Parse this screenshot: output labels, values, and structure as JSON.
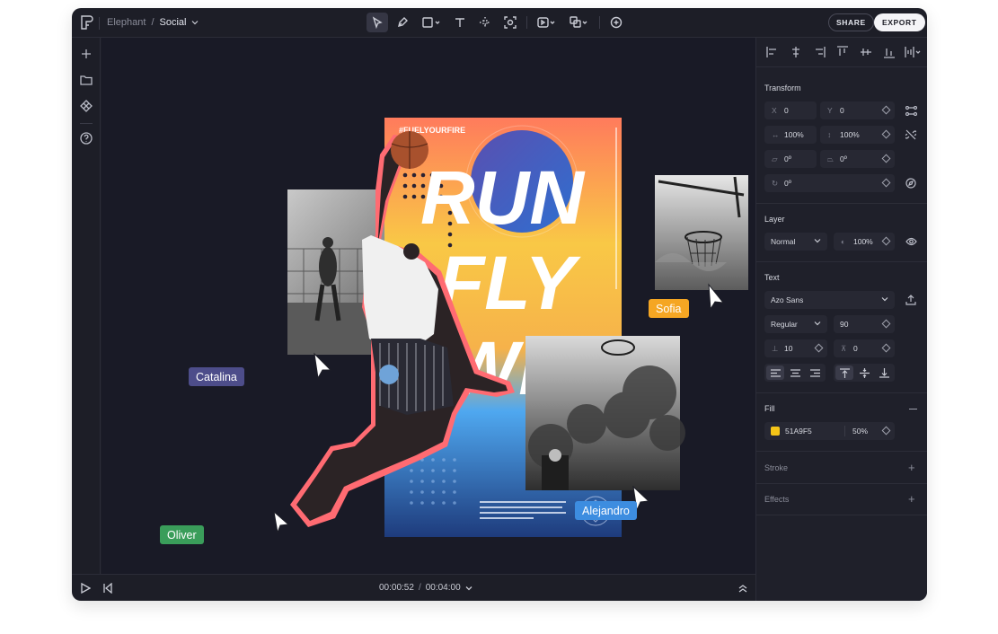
{
  "breadcrumb": {
    "project": "Elephant",
    "separator": "/",
    "page": "Social"
  },
  "header": {
    "share_label": "SHARE",
    "export_label": "EXPORT"
  },
  "toolbar": {
    "tools": [
      "select-icon",
      "pen-icon",
      "rectangle-icon",
      "text-icon",
      "grid-icon",
      "frame-capture-icon",
      "play-frame-icon",
      "boolean-icon",
      "comment-icon"
    ]
  },
  "poster": {
    "hashtag": "#FUELYOURFIRE",
    "lines": [
      "RUN",
      "FLY",
      "WIN"
    ],
    "colors": {
      "top": "#ff8a4c",
      "mid": "#f9c846",
      "bottom": "#2f4f9e"
    }
  },
  "collaborators": [
    {
      "name": "Catalina",
      "color": "#4d4d8a"
    },
    {
      "name": "Sofia",
      "color": "#f5a623"
    },
    {
      "name": "Oliver",
      "color": "#3a9d5a"
    },
    {
      "name": "Alejandro",
      "color": "#3d8de0"
    }
  ],
  "playback": {
    "current": "00:00:52",
    "separator": "/",
    "total": "00:04:00"
  },
  "panel": {
    "transform": {
      "title": "Transform",
      "x_label": "X",
      "x": "0",
      "y_label": "Y",
      "y": "0",
      "width": "100%",
      "height": "100%",
      "skew_x": "0º",
      "skew_y": "0º",
      "rotation": "0º"
    },
    "layer": {
      "title": "Layer",
      "blend": "Normal",
      "opacity": "100%"
    },
    "text": {
      "title": "Text",
      "font": "Azo Sans",
      "weight": "Regular",
      "size": "90",
      "line_height": "10",
      "letter_spacing": "0"
    },
    "fill": {
      "title": "Fill",
      "hex": "51A9F5",
      "opacity": "50%",
      "swatch": "#f5c518"
    },
    "stroke": {
      "title": "Stroke"
    },
    "effects": {
      "title": "Effects"
    }
  }
}
